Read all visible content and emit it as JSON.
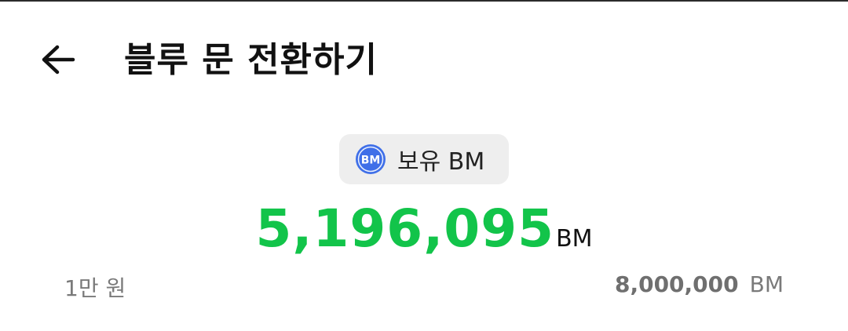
{
  "header": {
    "title": "블루 문 전환하기",
    "back_icon": "arrow-left-icon"
  },
  "balance": {
    "chip_label": "보유 BM",
    "coin_icon": "bm-coin-icon",
    "coin_text": "BM",
    "amount": "5,196,095",
    "unit": "BM"
  },
  "range": {
    "min_label": "1만 원",
    "max_value": "8,000,000",
    "max_unit": "BM"
  },
  "colors": {
    "amount": "#12c44a",
    "coin": "#3f6fe8",
    "chip_bg": "#eeeeee"
  }
}
